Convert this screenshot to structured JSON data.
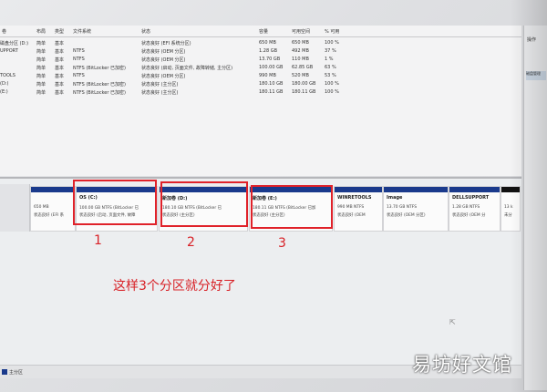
{
  "volume_list": {
    "columns": [
      "卷",
      "布局",
      "类型",
      "文件系统",
      "状态",
      "容量",
      "可用空间",
      "% 可用"
    ],
    "rows": [
      {
        "volume": "",
        "layout": "简单",
        "type": "基本",
        "fs": "",
        "status": "状态良好 (EFI 系统分区)",
        "capacity": "650 MB",
        "free": "650 MB",
        "pct": "100 %"
      },
      {
        "volume": "",
        "layout": "简单",
        "type": "基本",
        "fs": "NTFS",
        "status": "状态良好 (OEM 分区)",
        "capacity": "1.28 GB",
        "free": "492 MB",
        "pct": "37 %"
      },
      {
        "volume": "",
        "layout": "简单",
        "type": "基本",
        "fs": "NTFS",
        "status": "状态良好 (OEM 分区)",
        "capacity": "13.70 GB",
        "free": "110 MB",
        "pct": "1 %"
      },
      {
        "volume": "",
        "layout": "简单",
        "type": "基本",
        "fs": "NTFS (BitLocker 已加密)",
        "status": "状态良好 (启动, 页面文件, 故障转储, 主分区)",
        "capacity": "100.00 GB",
        "free": "62.85 GB",
        "pct": "63 %"
      },
      {
        "volume": "",
        "layout": "简单",
        "type": "基本",
        "fs": "NTFS",
        "status": "状态良好 (OEM 分区)",
        "capacity": "990 MB",
        "free": "520 MB",
        "pct": "53 %"
      },
      {
        "volume": "(D:)",
        "layout": "简单",
        "type": "基本",
        "fs": "NTFS (BitLocker 已加密)",
        "status": "状态良好 (主分区)",
        "capacity": "180.10 GB",
        "free": "180.00 GB",
        "pct": "100 %"
      },
      {
        "volume": "(E:)",
        "layout": "简单",
        "type": "基本",
        "fs": "NTFS (BitLocker 已加密)",
        "status": "状态良好 (主分区)",
        "capacity": "180.11 GB",
        "free": "180.11 GB",
        "pct": "100 %"
      }
    ],
    "partial_left_labels": [
      "磁盘分区 (D:)",
      "UPPORT",
      "",
      "",
      "TOOLS",
      "(D:)",
      "(E:)"
    ]
  },
  "actions_pane": {
    "title": "操作",
    "item": "磁盘管理"
  },
  "disk": {
    "label_line1": "",
    "label_line2": "",
    "partitions": [
      {
        "title": "",
        "line1": "650 MB",
        "line2": "状态良好 (EFI 系"
      },
      {
        "title": "OS  (C:)",
        "line1": "100.00 GB NTFS (BitLocker 已",
        "line2": "状态良好 (启动, 页面文件, 故障"
      },
      {
        "title": "新加卷  (D:)",
        "line1": "180.10 GB NTFS (BitLocker 已",
        "line2": "状态良好 (主分区)"
      },
      {
        "title": "新加卷  (E:)",
        "line1": "180.11 GB NTFS (BitLocker 已加",
        "line2": "状态良好 (主分区)"
      },
      {
        "title": "WINRETOOLS",
        "line1": "990 MB NTFS",
        "line2": "状态良好 (OEM"
      },
      {
        "title": "Image",
        "line1": "13.70 GB NTFS",
        "line2": "状态良好 (OEM 分区)"
      },
      {
        "title": "DELLSUPPORT",
        "line1": "1.28 GB NTFS",
        "line2": "状态良好 (OEM 分"
      },
      {
        "title": "",
        "line1": "13 k",
        "line2": "未分"
      }
    ]
  },
  "annotations": {
    "n1": "1",
    "n2": "2",
    "n3": "3",
    "caption": "这样3个分区就分好了"
  },
  "status_bar": {
    "legend": "主分区"
  },
  "watermark": "易坊好文馆",
  "colors": {
    "partition_bar": "#1a3a8c",
    "annotation": "#d82026"
  }
}
